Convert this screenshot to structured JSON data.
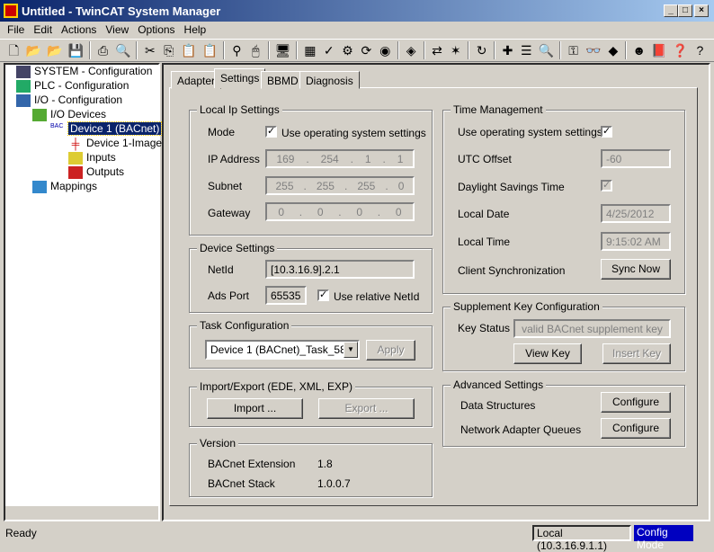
{
  "window": {
    "title": "Untitled - TwinCAT System Manager"
  },
  "menu": [
    "File",
    "Edit",
    "Actions",
    "View",
    "Options",
    "Help"
  ],
  "toolbar_icons": [
    "new-icon",
    "open-icon",
    "open-project-icon",
    "save-icon",
    "print-icon",
    "print-preview-icon",
    "cut-icon",
    "copy-icon",
    "paste-icon",
    "paste-with-links-icon",
    "find-icon",
    "mouse-icon",
    "target-system-icon",
    "generate-mappings-icon",
    "check-icon",
    "activate-config-icon",
    "restart-icon",
    "config-mode-icon",
    "load-io-icon",
    "scan-devices-icon",
    "wizard-icon",
    "reload-icon",
    "add-item-icon",
    "show-online-data-icon",
    "zoom-icon",
    "free-run-icon",
    "watch-icon",
    "diagnostics-icon",
    "iq-icon",
    "help-book-icon",
    "help-topic-icon",
    "whats-this-icon"
  ],
  "tree": {
    "items": [
      "SYSTEM - Configuration",
      "PLC - Configuration",
      "I/O - Configuration",
      "I/O Devices",
      "Device 1 (BACnet)",
      "Device 1-Image",
      "Inputs",
      "Outputs",
      "Mappings"
    ]
  },
  "tabs": [
    "Adapter",
    "Settings",
    "BBMD",
    "Diagnosis"
  ],
  "local_ip": {
    "title": "Local Ip Settings",
    "mode_label": "Mode",
    "use_os": "Use operating system settings",
    "ip_label": "IP Address",
    "ip": [
      "169",
      "254",
      "1",
      "1"
    ],
    "subnet_label": "Subnet",
    "subnet": [
      "255",
      "255",
      "255",
      "0"
    ],
    "gateway_label": "Gateway",
    "gateway": [
      "0",
      "0",
      "0",
      "0"
    ]
  },
  "device": {
    "title": "Device Settings",
    "netid_label": "NetId",
    "netid": "[10.3.16.9].2.1",
    "ads_label": "Ads Port",
    "ads": "65535",
    "relative": "Use relative NetId"
  },
  "task": {
    "title": "Task Configuration",
    "selected": "Device 1 (BACnet)_Task_58",
    "apply": "Apply"
  },
  "import_export": {
    "title": "Import/Export (EDE, XML, EXP)",
    "import": "Import ...",
    "export": "Export ..."
  },
  "version": {
    "title": "Version",
    "ext_label": "BACnet Extension",
    "ext": "1.8",
    "stack_label": "BACnet Stack",
    "stack": "1.0.0.7"
  },
  "time": {
    "title": "Time Management",
    "use_os": "Use operating system settings",
    "utc_label": "UTC Offset",
    "utc": "-60",
    "dst_label": "Daylight Savings Time",
    "date_label": "Local Date",
    "date": "4/25/2012",
    "time_label": "Local Time",
    "time": "9:15:02 AM",
    "sync_label": "Client Synchronization",
    "sync_btn": "Sync Now"
  },
  "supp": {
    "title": "Supplement Key Configuration",
    "status_label": "Key Status",
    "status": "valid BACnet supplement key",
    "view": "View Key",
    "insert": "Insert Key"
  },
  "adv": {
    "title": "Advanced Settings",
    "ds_label": "Data Structures",
    "naq_label": "Network Adapter Queues",
    "configure": "Configure"
  },
  "status": {
    "text": "Ready",
    "target": "Local (10.3.16.9.1.1)",
    "mode": "Config Mode"
  }
}
